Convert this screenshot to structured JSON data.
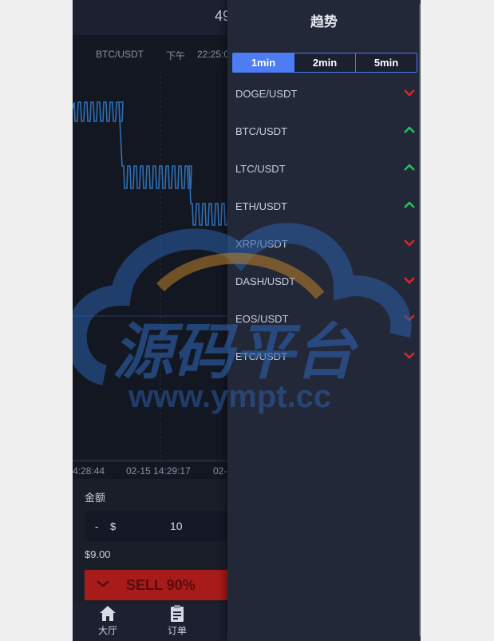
{
  "header": {
    "value": "49"
  },
  "subheader": {
    "pair": "BTC/USDT",
    "ampm": "下午",
    "time": "22:25:0"
  },
  "chart": {
    "x_labels": [
      "4:28:44",
      "02-15 14:29:17",
      "02-"
    ]
  },
  "trade": {
    "amount_label": "金额",
    "minus": "-",
    "currency": "$",
    "amount_value": "10",
    "fee": "$9.00",
    "sell_label": "SELL 90%"
  },
  "tabs": [
    {
      "label": "大厅",
      "icon": "home-icon"
    },
    {
      "label": "订单",
      "icon": "clipboard-icon"
    }
  ],
  "panel": {
    "title": "趋势",
    "intervals": [
      "1min",
      "2min",
      "5min"
    ],
    "active_interval": "1min",
    "items": [
      {
        "name": "DOGE/USDT",
        "trend": "down"
      },
      {
        "name": "BTC/USDT",
        "trend": "up"
      },
      {
        "name": "LTC/USDT",
        "trend": "up"
      },
      {
        "name": "ETH/USDT",
        "trend": "up"
      },
      {
        "name": "XRP/USDT",
        "trend": "down"
      },
      {
        "name": "DASH/USDT",
        "trend": "down"
      },
      {
        "name": "EOS/USDT",
        "trend": "down"
      },
      {
        "name": "ETC/USDT",
        "trend": "down"
      }
    ]
  },
  "watermark": {
    "cn": "源码平台",
    "url": "www.ympt.cc"
  },
  "colors": {
    "up": "#22c55e",
    "down": "#dc2626",
    "accent": "#4d7cf5",
    "line": "#2f6fb5"
  }
}
